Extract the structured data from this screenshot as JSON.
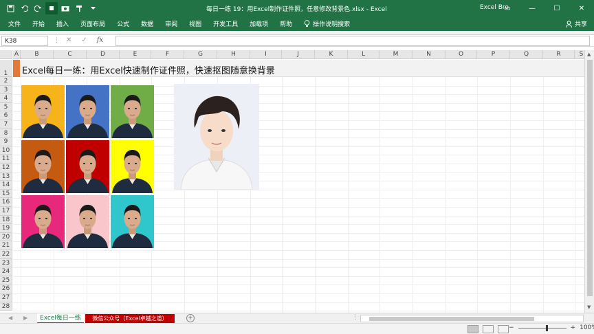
{
  "window": {
    "title": "每日一练 19：用Excel制作证件照，任意修改背景色.xlsx  -  Excel",
    "user": "Excel Bro"
  },
  "ribbon": {
    "tabs": [
      "文件",
      "开始",
      "插入",
      "页面布局",
      "公式",
      "数据",
      "审阅",
      "视图",
      "开发工具",
      "加载项",
      "帮助"
    ],
    "tell_me": "操作说明搜索",
    "share": "共享"
  },
  "formula_bar": {
    "name_box": "K38",
    "formula": ""
  },
  "columns": [
    "A",
    "B",
    "C",
    "D",
    "E",
    "F",
    "G",
    "H",
    "I",
    "J",
    "K",
    "L",
    "M",
    "N",
    "O",
    "P",
    "Q",
    "R",
    "S"
  ],
  "rows": [
    "1",
    "2",
    "3",
    "4",
    "5",
    "6",
    "7",
    "8",
    "9",
    "10",
    "11",
    "12",
    "13",
    "14",
    "15",
    "16",
    "17",
    "18",
    "19",
    "20",
    "21",
    "22",
    "23",
    "24",
    "25",
    "26",
    "27",
    "28"
  ],
  "sheet": {
    "title_cell": "Excel每日一练：用Excel快速制作证件照，快速抠图随意换背景"
  },
  "photos": {
    "backgrounds": [
      "#f6b31a",
      "#4472c4",
      "#70ad47",
      "#c55a11",
      "#c00000",
      "#ffff00",
      "#e8287a",
      "#f9c6cb",
      "#2fc7cc"
    ]
  },
  "sheet_tabs": [
    "Excel每日一练",
    "微信公众号（Excel卓越之道）"
  ],
  "status": {
    "zoom": "100%"
  },
  "colors": {
    "accent": "#217346",
    "title_bar": "#e2793a",
    "tab_red": "#c00000"
  }
}
